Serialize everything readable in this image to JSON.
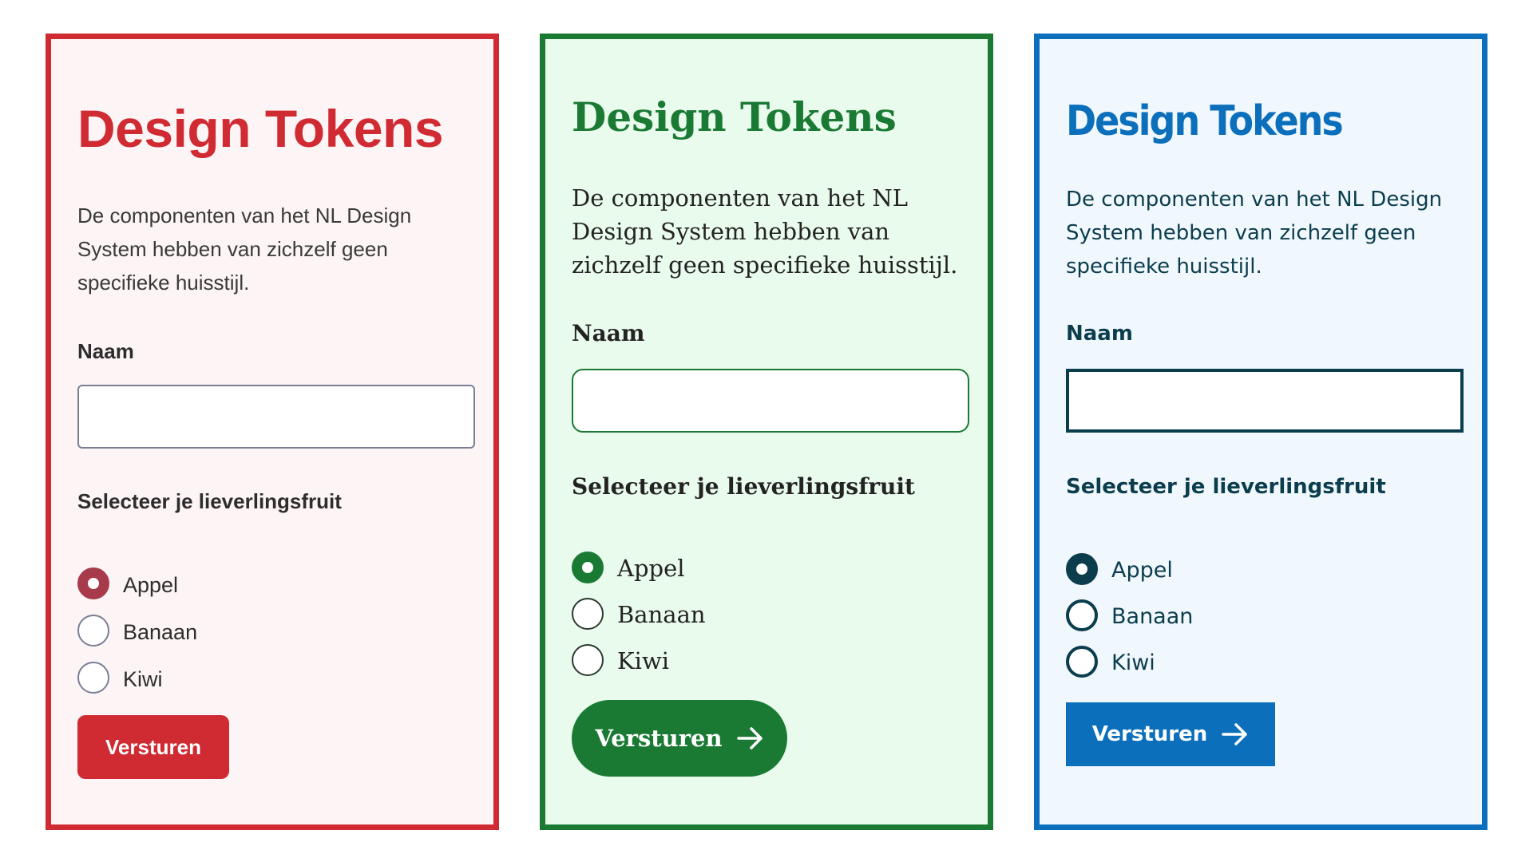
{
  "cards": [
    {
      "theme": "red",
      "colors": {
        "accent": "#d02a33",
        "background": "#fdf4f5",
        "checked_radio": "#a73a4b"
      },
      "title": "Design Tokens",
      "paragraph": "De componenten van het NL Design System hebben van zichzelf geen specifieke huisstijl.",
      "name_label": "Naam",
      "name_value": "",
      "fruit_legend": "Selecteer je lieverlingsfruit",
      "options": [
        "Appel",
        "Banaan",
        "Kiwi"
      ],
      "selected_option": "Appel",
      "submit_label": "Versturen",
      "submit_icon": null
    },
    {
      "theme": "green",
      "colors": {
        "accent": "#1a7a34",
        "background": "#e9fbec",
        "checked_radio": "#1a7a34"
      },
      "title": "Design Tokens",
      "paragraph": "De componenten van het NL Design System hebben van zichzelf geen specifieke huisstijl.",
      "name_label": "Naam",
      "name_value": "",
      "fruit_legend": "Selecteer je lieverlingsfruit",
      "options": [
        "Appel",
        "Banaan",
        "Kiwi"
      ],
      "selected_option": "Appel",
      "submit_label": "Versturen",
      "submit_icon": "arrow-right-icon"
    },
    {
      "theme": "blue",
      "colors": {
        "accent": "#0b6fbb",
        "background": "#f0f7fd",
        "text": "#0b3d4d",
        "checked_radio": "#0b3d4d"
      },
      "title": "Design Tokens",
      "paragraph": "De componenten van het NL Design System hebben van zichzelf geen specifieke huisstijl.",
      "name_label": "Naam",
      "name_value": "",
      "fruit_legend": "Selecteer je lieverlingsfruit",
      "options": [
        "Appel",
        "Banaan",
        "Kiwi"
      ],
      "selected_option": "Appel",
      "submit_label": "Versturen",
      "submit_icon": "arrow-right-icon"
    }
  ]
}
